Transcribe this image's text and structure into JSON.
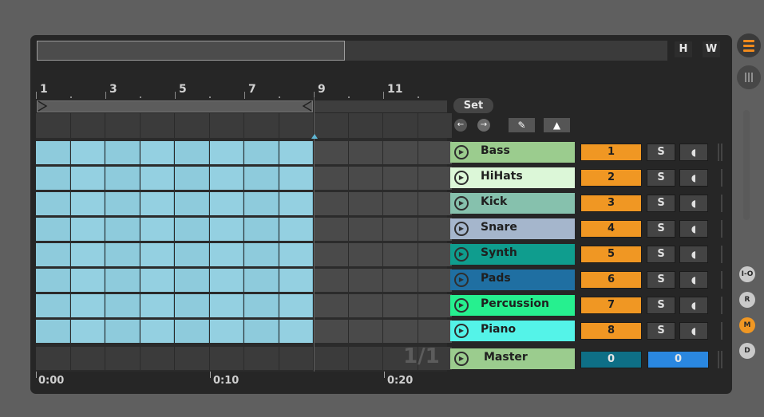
{
  "toolbar": {
    "h_label": "H",
    "w_label": "W"
  },
  "ruler": {
    "bars": [
      "1",
      "3",
      "5",
      "7",
      "9",
      "11"
    ]
  },
  "timeline": {
    "times": [
      "0:00",
      "0:10",
      "0:20"
    ],
    "page_indicator": "1/1"
  },
  "set_panel": {
    "label": "Set"
  },
  "tracks": [
    {
      "name": "Bass",
      "number": "1",
      "solo_label": "S",
      "color": "#9bcc8e"
    },
    {
      "name": "HiHats",
      "number": "2",
      "solo_label": "S",
      "color": "#dcf7d8"
    },
    {
      "name": "Kick",
      "number": "3",
      "solo_label": "S",
      "color": "#86c1ad"
    },
    {
      "name": "Snare",
      "number": "4",
      "solo_label": "S",
      "color": "#a5b6cc"
    },
    {
      "name": "Synth",
      "number": "5",
      "solo_label": "S",
      "color": "#0f9d8e"
    },
    {
      "name": "Pads",
      "number": "6",
      "solo_label": "S",
      "color": "#1f6fa2"
    },
    {
      "name": "Percussion",
      "number": "7",
      "solo_label": "S",
      "color": "#26f08f"
    },
    {
      "name": "Piano",
      "number": "8",
      "solo_label": "S",
      "color": "#54f3e8"
    }
  ],
  "master": {
    "name": "Master",
    "value_left": "0",
    "value_right": "0",
    "color": "#9bcc8e"
  },
  "side_buttons": [
    "I-O",
    "R",
    "M",
    "D"
  ],
  "colors": {
    "clip": "#8ecbdc",
    "clip_alt": "#94d0e1",
    "empty_cell": "#4a4a4a",
    "accent": "#f09723"
  }
}
